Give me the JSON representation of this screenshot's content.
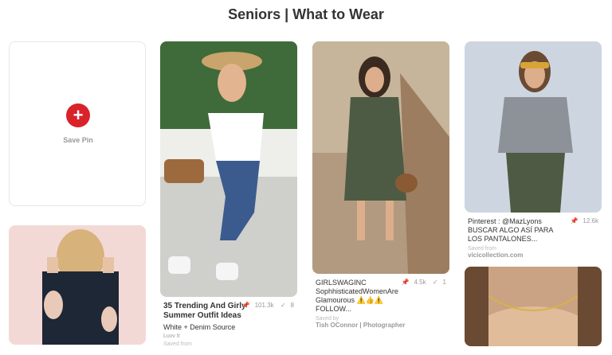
{
  "board": {
    "title": "Seniors | What to Wear"
  },
  "save_pin": {
    "label": "Save Pin",
    "plus": "+"
  },
  "pins": [
    {
      "title": "35 Trending And Girly Summer Outfit Ideas",
      "repins": "101.3k",
      "likes": "8",
      "subtitle": "White + Denim Source",
      "source": "Luvv It",
      "saved_from": "Saved from"
    },
    {
      "description": "GIRLSWAGINC SophhisticatedWomenAre Glamourous ⚠️👍⚠️ FOLLOW...",
      "repins": "4.5k",
      "likes": "1",
      "saved_from": "Saved by",
      "source": "Tish OConnor | Photographer"
    },
    {
      "description": "Pinterest : @MazLyons BUSCAR ALGO ASÍ PARA LOS PANTALONES...",
      "repins": "12.6k",
      "saved_from": "Saved from",
      "source": "vicicollection.com"
    }
  ],
  "icons": {
    "pin": "pin-icon",
    "heart": "check-icon"
  }
}
